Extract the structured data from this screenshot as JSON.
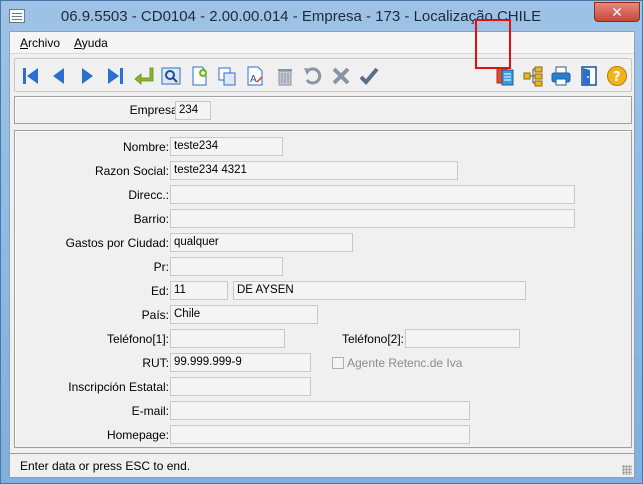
{
  "window": {
    "title": "06.9.5503 - CD0104 - 2.00.00.014 - Empresa - 173 - Localização CHILE",
    "close_label": "✕"
  },
  "menu": {
    "items": [
      {
        "label": "Archivo"
      },
      {
        "label": "Ayuda"
      }
    ]
  },
  "toolbar": {
    "buttons": [
      {
        "name": "first-record-icon"
      },
      {
        "name": "previous-record-icon"
      },
      {
        "name": "next-record-icon"
      },
      {
        "name": "last-record-icon"
      },
      {
        "name": "confirm-enter-icon"
      },
      {
        "name": "search-icon"
      },
      {
        "name": "new-record-icon"
      },
      {
        "name": "copy-record-icon"
      },
      {
        "name": "edit-record-icon"
      },
      {
        "name": "delete-trash-icon"
      },
      {
        "name": "undo-icon"
      },
      {
        "name": "cancel-x-icon"
      },
      {
        "name": "save-check-icon"
      },
      {
        "name": "documents-icon"
      },
      {
        "name": "tree-structure-icon"
      },
      {
        "name": "print-icon"
      },
      {
        "name": "exit-door-icon"
      },
      {
        "name": "help-icon"
      }
    ]
  },
  "header_panel": {
    "empresa_label": "Empresa:",
    "empresa_value": "234"
  },
  "form": {
    "nombre": {
      "label": "Nombre:",
      "value": "teste234"
    },
    "razon_social": {
      "label": "Razon Social:",
      "value": "teste234 4321"
    },
    "direcc": {
      "label": "Direcc.:",
      "value": ""
    },
    "barrio": {
      "label": "Barrio:",
      "value": ""
    },
    "gastos": {
      "label": "Gastos por Ciudad:",
      "value": "qualquer"
    },
    "pr": {
      "label": "Pr:",
      "value": ""
    },
    "ed": {
      "label": "Ed:",
      "code": "11",
      "name": "DE AYSEN"
    },
    "pais": {
      "label": "País:",
      "value": "Chile"
    },
    "telefono1": {
      "label": "Teléfono[1]:",
      "value": ""
    },
    "telefono2": {
      "label": "Teléfono[2]:",
      "value": ""
    },
    "rut": {
      "label": "RUT:",
      "value": "99.999.999-9"
    },
    "agente": {
      "label": "Agente Retenc.de Iva",
      "checked": false
    },
    "inscripcion": {
      "label": "Inscripción Estatal:",
      "value": ""
    },
    "email": {
      "label": "E-mail:",
      "value": ""
    },
    "homepage": {
      "label": "Homepage:",
      "value": ""
    }
  },
  "status": {
    "text": "Enter data or press ESC to end."
  },
  "colors": {
    "accent": "#2a6fd1",
    "highlight": "#e01010",
    "title_bg": "#8fb8e0"
  }
}
